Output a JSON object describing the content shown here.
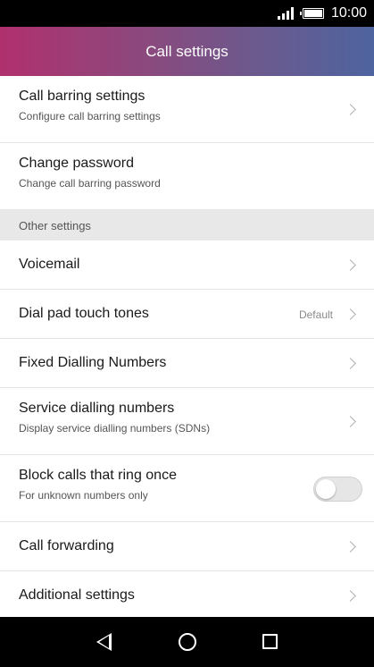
{
  "status_bar": {
    "time": "10:00"
  },
  "header": {
    "title": "Call settings"
  },
  "rows_top": [
    {
      "title": "Call barring settings",
      "subtitle": "Configure call barring settings"
    },
    {
      "title": "Change password",
      "subtitle": "Change call barring password"
    }
  ],
  "section": {
    "label": "Other settings"
  },
  "rows": {
    "voicemail": {
      "title": "Voicemail"
    },
    "dial_pad": {
      "title": "Dial pad touch tones",
      "value": "Default"
    },
    "fdn": {
      "title": "Fixed Dialling Numbers"
    },
    "sdn": {
      "title": "Service dialling numbers",
      "subtitle": "Display service dialling numbers (SDNs)"
    },
    "block_once": {
      "title": "Block calls that ring once",
      "subtitle": "For unknown numbers only",
      "toggle_on": false
    },
    "forwarding": {
      "title": "Call forwarding"
    },
    "additional": {
      "title": "Additional settings"
    }
  },
  "icons": {
    "signal": "signal-icon",
    "battery": "battery-icon",
    "chevron": "chevron-right-icon",
    "back": "back-icon",
    "home": "home-icon",
    "recent": "recent-apps-icon"
  },
  "colors": {
    "header_gradient_start": "#b0306e",
    "header_gradient_end": "#4e64a0",
    "section_bg": "#e8e8e8"
  }
}
